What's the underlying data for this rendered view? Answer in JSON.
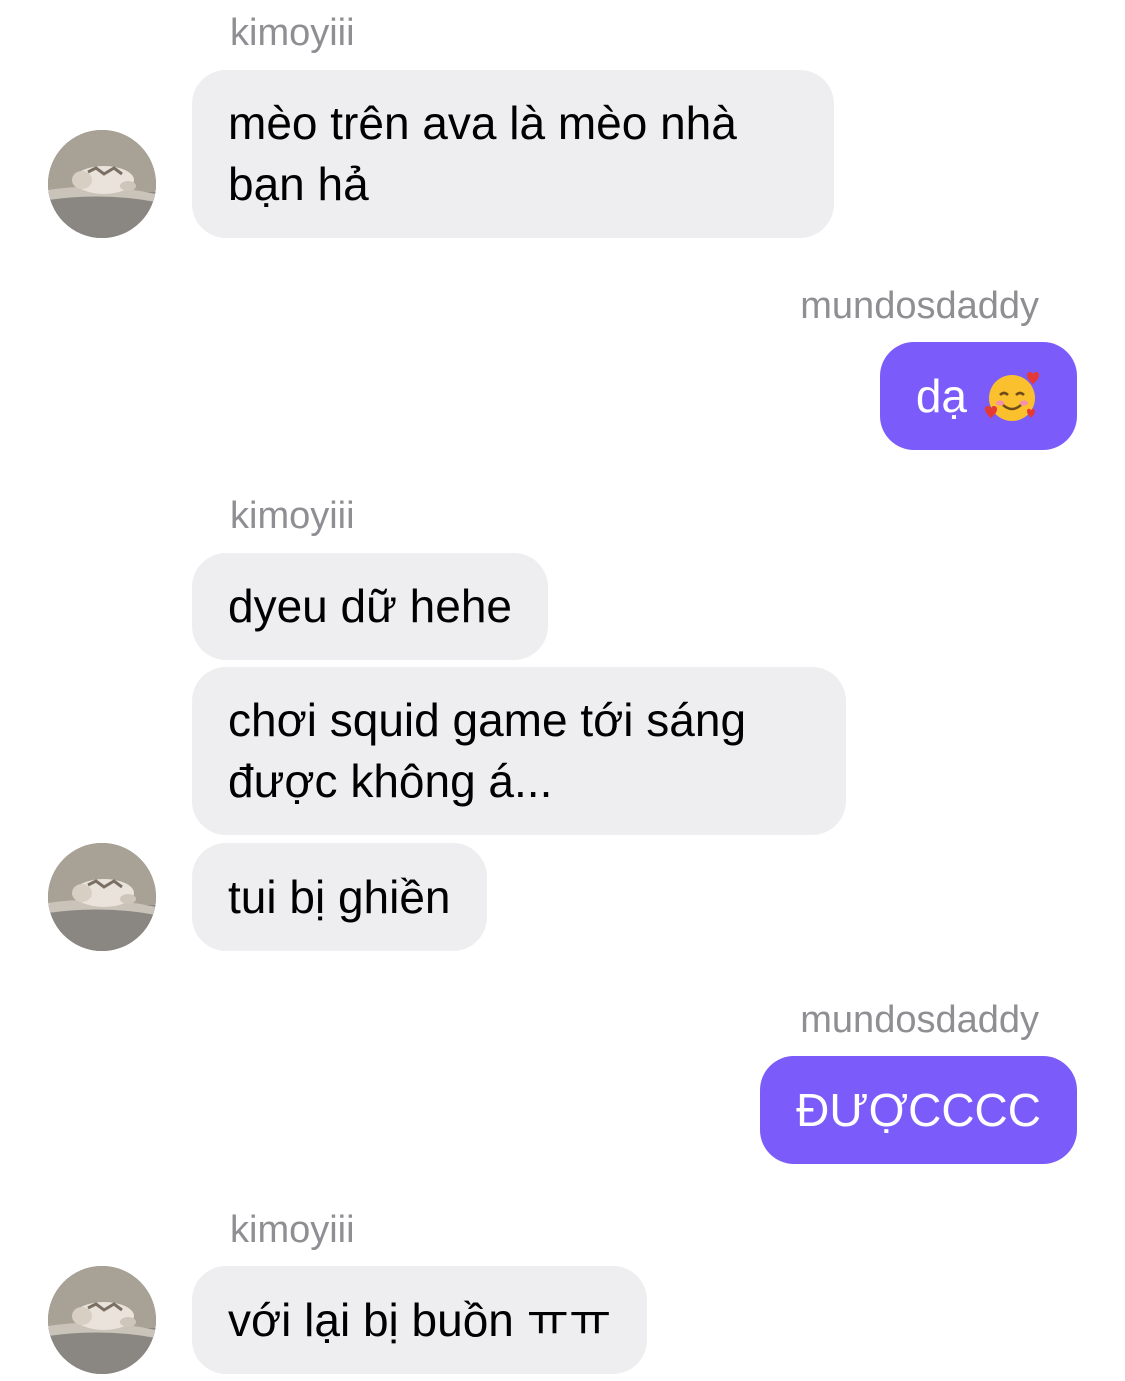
{
  "colors": {
    "incoming_bubble": "#eeeef0",
    "outgoing_bubble": "#7b5cfa",
    "sender_name": "#8e8e93"
  },
  "messages": [
    {
      "sender": "kimoyiii",
      "text": "mèo trên ava là mèo nhà\nbạn hả"
    },
    {
      "sender": "mundosdaddy",
      "text": "dạ",
      "emoji": "smiling-face-with-hearts-icon"
    },
    {
      "sender": "kimoyiii",
      "text": "dyeu dữ hehe"
    },
    {
      "sender": "kimoyiii",
      "text": "chơi squid game tới sáng\nđược không á..."
    },
    {
      "sender": "kimoyiii",
      "text": "tui bị ghiền"
    },
    {
      "sender": "mundosdaddy",
      "text": "ĐƯỢCCCC"
    },
    {
      "sender": "kimoyiii",
      "text": "với lại bị buồn ㅠㅠ"
    }
  ],
  "avatar": "cat-avatar-icon"
}
